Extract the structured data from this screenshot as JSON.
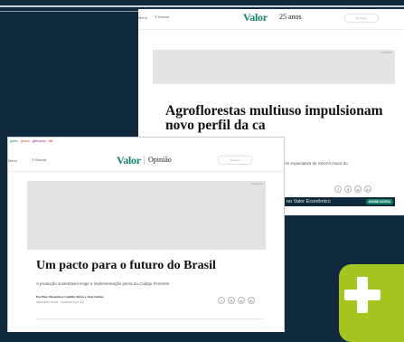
{
  "back_page": {
    "header": {
      "menu_label": "Menu",
      "search_label": "Buscar",
      "logo": "Valor",
      "anniversary": "25 anos",
      "nav_pill": "Navegue"
    },
    "ad_label": "Publicidade",
    "headline": "Agroflorestas multiuso impulsionam novo perfil da ca",
    "subtitle_fragment": "om expectativa de retorno maior do",
    "share_icons": [
      "f",
      "X",
      "w",
      "in"
    ],
    "promo": {
      "text": "no Valor Econômico",
      "button": "ASSINE AGORA"
    }
  },
  "front_page": {
    "browser_tabs": [
      "globo",
      "gnews",
      "globoplay",
      "sbt"
    ],
    "header": {
      "menu_label": "Menu",
      "search_label": "Buscar",
      "logo": "Valor",
      "section": "Opinião",
      "nav_pill": "Navegue"
    },
    "ad_label": "Publicidade",
    "headline": "Um pacto para o futuro do Brasil",
    "lead": "A produção sustentável exige a implementação plena do Código Florestal",
    "byline": "Por Beto Mesquita e Camille Abreu e João Sabino",
    "date": "06/03/2025 07h00 · Atualizado há 1 ano",
    "share_icons": [
      "f",
      "X",
      "w",
      "in"
    ]
  },
  "colors": {
    "background": "#0e2a3c",
    "brand_green": "#13806a",
    "plus_badge": "#a6c521"
  },
  "badge_icon": "plus-icon"
}
